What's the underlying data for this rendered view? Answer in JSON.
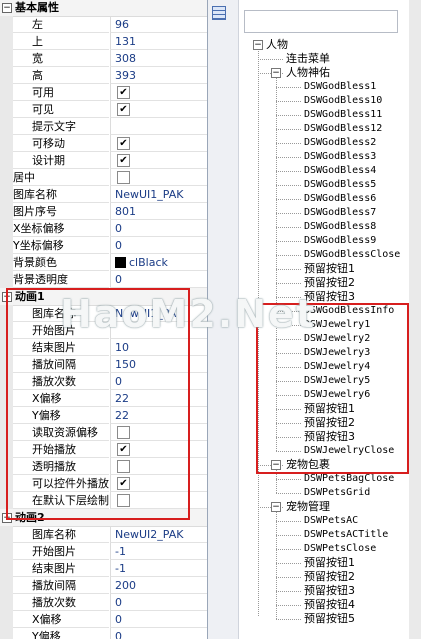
{
  "property_grid": {
    "rows": [
      {
        "kind": "group",
        "label": "基本属性",
        "expanded": true
      },
      {
        "kind": "prop",
        "label": "左",
        "value": "96",
        "indent": true
      },
      {
        "kind": "prop",
        "label": "上",
        "value": "131",
        "indent": true
      },
      {
        "kind": "prop",
        "label": "宽",
        "value": "308",
        "indent": true
      },
      {
        "kind": "prop",
        "label": "高",
        "value": "393",
        "indent": true
      },
      {
        "kind": "check",
        "label": "可用",
        "checked": true,
        "indent": true
      },
      {
        "kind": "check",
        "label": "可见",
        "checked": true,
        "indent": true
      },
      {
        "kind": "prop",
        "label": "提示文字",
        "value": "",
        "indent": true
      },
      {
        "kind": "check",
        "label": "可移动",
        "checked": true,
        "indent": true
      },
      {
        "kind": "check",
        "label": "设计期",
        "checked": true,
        "indent": true
      },
      {
        "kind": "check",
        "label": "居中",
        "checked": false,
        "indent": false
      },
      {
        "kind": "prop",
        "label": "图库名称",
        "value": "NewUI1_PAK",
        "indent": false
      },
      {
        "kind": "prop",
        "label": "图片序号",
        "value": "801",
        "indent": false
      },
      {
        "kind": "prop",
        "label": "X坐标偏移",
        "value": "0",
        "indent": false
      },
      {
        "kind": "prop",
        "label": "Y坐标偏移",
        "value": "0",
        "indent": false
      },
      {
        "kind": "color",
        "label": "背景颜色",
        "value": "clBlack",
        "indent": false
      },
      {
        "kind": "prop",
        "label": "背景透明度",
        "value": "0",
        "indent": false
      },
      {
        "kind": "group",
        "label": "动画1",
        "expanded": true
      },
      {
        "kind": "prop",
        "label": "图库名称",
        "value": "NewUI1_PA",
        "indent": true
      },
      {
        "kind": "prop",
        "label": "开始图片",
        "value": "",
        "indent": true
      },
      {
        "kind": "prop",
        "label": "结束图片",
        "value": "10",
        "indent": true
      },
      {
        "kind": "prop",
        "label": "播放间隔",
        "value": "150",
        "indent": true
      },
      {
        "kind": "prop",
        "label": "播放次数",
        "value": "0",
        "indent": true
      },
      {
        "kind": "prop",
        "label": "X偏移",
        "value": "22",
        "indent": true
      },
      {
        "kind": "prop",
        "label": "Y偏移",
        "value": "22",
        "indent": true
      },
      {
        "kind": "check",
        "label": "读取资源偏移",
        "checked": false,
        "indent": true
      },
      {
        "kind": "check",
        "label": "开始播放",
        "checked": true,
        "indent": true
      },
      {
        "kind": "check",
        "label": "透明播放",
        "checked": false,
        "indent": true
      },
      {
        "kind": "check",
        "label": "可以控件外播放",
        "checked": true,
        "indent": true
      },
      {
        "kind": "check",
        "label": "在默认下层绘制",
        "checked": false,
        "indent": true
      },
      {
        "kind": "group",
        "label": "动画2",
        "expanded": true
      },
      {
        "kind": "prop",
        "label": "图库名称",
        "value": "NewUI2_PAK",
        "indent": true
      },
      {
        "kind": "prop",
        "label": "开始图片",
        "value": "-1",
        "indent": true
      },
      {
        "kind": "prop",
        "label": "结束图片",
        "value": "-1",
        "indent": true
      },
      {
        "kind": "prop",
        "label": "播放间隔",
        "value": "200",
        "indent": true
      },
      {
        "kind": "prop",
        "label": "播放次数",
        "value": "0",
        "indent": true
      },
      {
        "kind": "prop",
        "label": "X偏移",
        "value": "0",
        "indent": true
      },
      {
        "kind": "prop",
        "label": "Y偏移",
        "value": "0",
        "indent": true
      }
    ]
  },
  "tree": {
    "nodes": [
      {
        "label": "人物",
        "level": 0,
        "expander": "-"
      },
      {
        "label": "连击菜单",
        "level": 1
      },
      {
        "label": "人物神佑",
        "level": 1,
        "expander": "-"
      },
      {
        "label": "DSWGodBless1",
        "level": 2
      },
      {
        "label": "DSWGodBless10",
        "level": 2
      },
      {
        "label": "DSWGodBless11",
        "level": 2
      },
      {
        "label": "DSWGodBless12",
        "level": 2
      },
      {
        "label": "DSWGodBless2",
        "level": 2
      },
      {
        "label": "DSWGodBless3",
        "level": 2
      },
      {
        "label": "DSWGodBless4",
        "level": 2
      },
      {
        "label": "DSWGodBless5",
        "level": 2
      },
      {
        "label": "DSWGodBless6",
        "level": 2
      },
      {
        "label": "DSWGodBless7",
        "level": 2
      },
      {
        "label": "DSWGodBless8",
        "level": 2
      },
      {
        "label": "DSWGodBless9",
        "level": 2
      },
      {
        "label": "DSWGodBlessClose",
        "level": 2
      },
      {
        "label": "预留按钮1",
        "level": 2
      },
      {
        "label": "预留按钮2",
        "level": 2
      },
      {
        "label": "预留按钮3",
        "level": 2
      },
      {
        "label": "DSWGodBlessInfo",
        "level": 2
      },
      {
        "label": "DSWJewelry1",
        "level": 2
      },
      {
        "label": "DSWJewelry2",
        "level": 2
      },
      {
        "label": "DSWJewelry3",
        "level": 2
      },
      {
        "label": "DSWJewelry4",
        "level": 2
      },
      {
        "label": "DSWJewelry5",
        "level": 2
      },
      {
        "label": "DSWJewelry6",
        "level": 2
      },
      {
        "label": "预留按钮1",
        "level": 2
      },
      {
        "label": "预留按钮2",
        "level": 2
      },
      {
        "label": "预留按钮3",
        "level": 2
      },
      {
        "label": "DSWJewelryClose",
        "level": 2
      },
      {
        "label": "宠物包裹",
        "level": 1,
        "expander": "-"
      },
      {
        "label": "DSWPetsBagClose",
        "level": 2
      },
      {
        "label": "DSWPetsGrid",
        "level": 2
      },
      {
        "label": "宠物管理",
        "level": 1,
        "expander": "-"
      },
      {
        "label": "DSWPetsAC",
        "level": 2
      },
      {
        "label": "DSWPetsACTitle",
        "level": 2
      },
      {
        "label": "DSWPetsClose",
        "level": 2
      },
      {
        "label": "预留按钮1",
        "level": 2
      },
      {
        "label": "预留按钮2",
        "level": 2
      },
      {
        "label": "预留按钮3",
        "level": 2
      },
      {
        "label": "预留按钮4",
        "level": 2
      },
      {
        "label": "预留按钮5",
        "level": 2
      }
    ]
  },
  "watermark": "HaoM2.Net",
  "check_mark": "✔",
  "colors": {
    "highlight": "#d71e1e",
    "value_text": "#1b3c86"
  }
}
